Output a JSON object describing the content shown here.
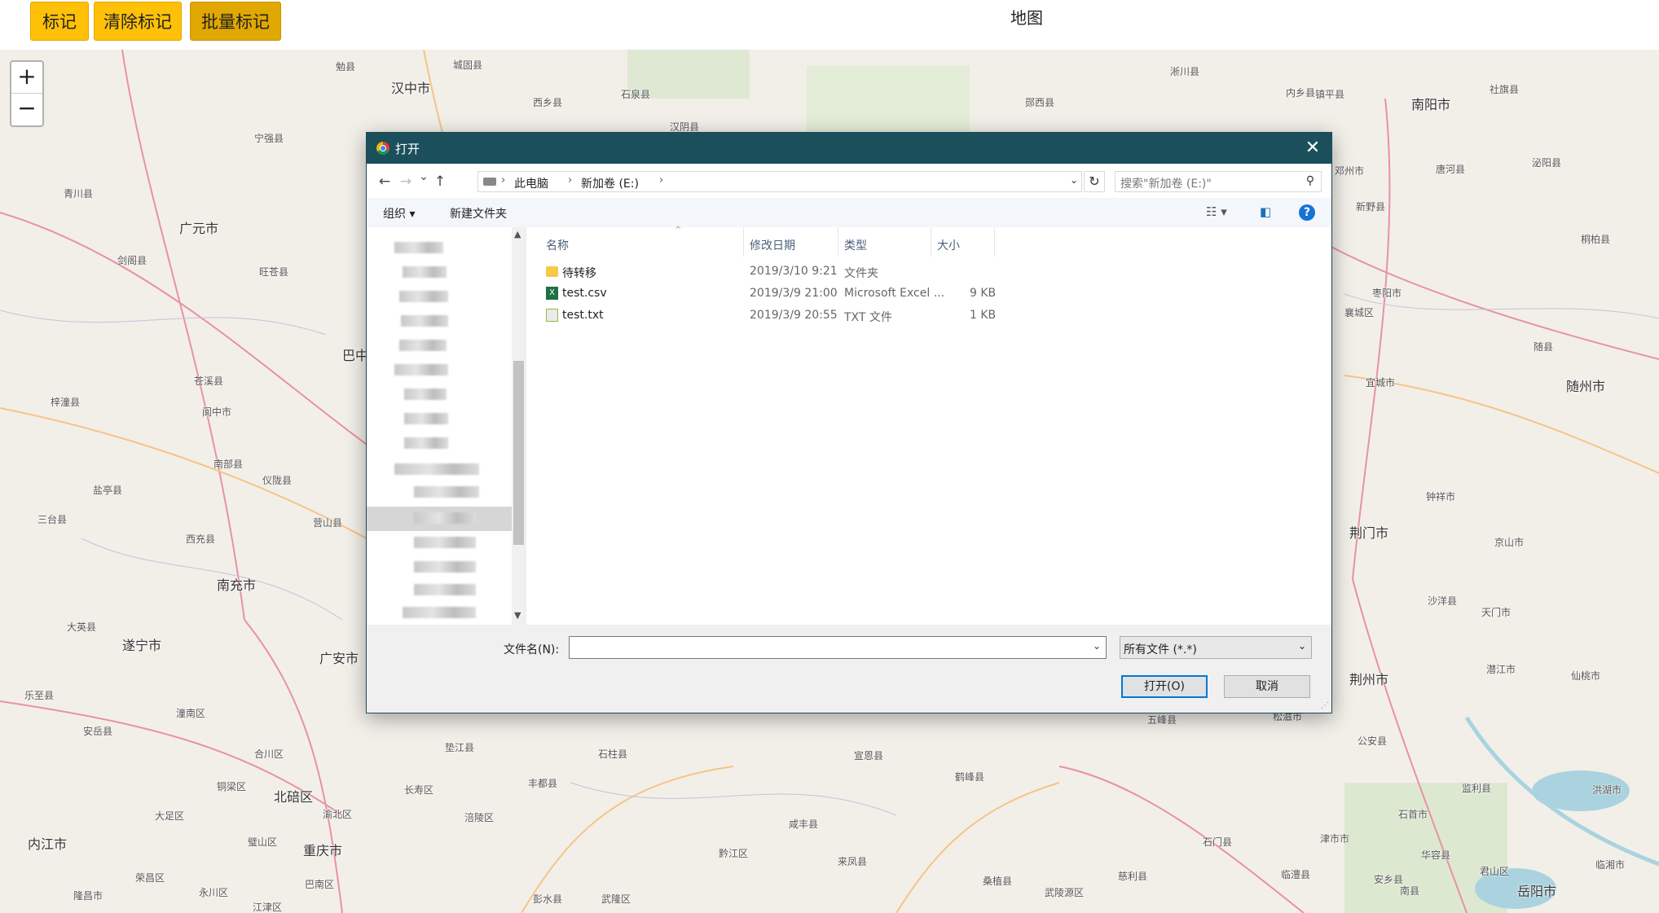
{
  "toolbar": {
    "mark_label": "标记",
    "clear_label": "清除标记",
    "batch_label": "批量标记",
    "map_title": "地图"
  },
  "zoom": {
    "in": "+",
    "out": "−"
  },
  "map_labels": [
    {
      "text": "汉中市",
      "city": true
    },
    {
      "text": "南阳市",
      "city": true
    },
    {
      "text": "广元市",
      "city": true
    },
    {
      "text": "巴中",
      "city": true
    },
    {
      "text": "南充市",
      "city": true
    },
    {
      "text": "遂宁市",
      "city": true
    },
    {
      "text": "广安市",
      "city": true
    },
    {
      "text": "北碚区",
      "city": true
    },
    {
      "text": "重庆市",
      "city": true
    },
    {
      "text": "内江市",
      "city": true
    },
    {
      "text": "荆门市",
      "city": true
    },
    {
      "text": "荆州市",
      "city": true
    },
    {
      "text": "随州市",
      "city": true
    },
    {
      "text": "岳阳市",
      "city": true
    },
    {
      "text": "宁强县",
      "city": false
    },
    {
      "text": "青川县",
      "city": false
    },
    {
      "text": "剑阁县",
      "city": false
    },
    {
      "text": "旺苍县",
      "city": false
    },
    {
      "text": "苍溪县",
      "city": false
    },
    {
      "text": "阆中市",
      "city": false
    },
    {
      "text": "梓潼县",
      "city": false
    },
    {
      "text": "南部县",
      "city": false
    },
    {
      "text": "仪陇县",
      "city": false
    },
    {
      "text": "盐亭县",
      "city": false
    },
    {
      "text": "三台县",
      "city": false
    },
    {
      "text": "西充县",
      "city": false
    },
    {
      "text": "营山县",
      "city": false
    },
    {
      "text": "大英县",
      "city": false
    },
    {
      "text": "乐至县",
      "city": false
    },
    {
      "text": "安岳县",
      "city": false
    },
    {
      "text": "潼南区",
      "city": false
    },
    {
      "text": "合川区",
      "city": false
    },
    {
      "text": "铜梁区",
      "city": false
    },
    {
      "text": "大足区",
      "city": false
    },
    {
      "text": "长寿区",
      "city": false
    },
    {
      "text": "涪陵区",
      "city": false
    },
    {
      "text": "丰都县",
      "city": false
    },
    {
      "text": "石柱县",
      "city": false
    },
    {
      "text": "宣恩县",
      "city": false
    },
    {
      "text": "鹤峰县",
      "city": false
    },
    {
      "text": "五峰县",
      "city": false
    },
    {
      "text": "松滋市",
      "city": false
    },
    {
      "text": "公安县",
      "city": false
    },
    {
      "text": "监利县",
      "city": false
    },
    {
      "text": "洪湖市",
      "city": false
    },
    {
      "text": "石首市",
      "city": false
    },
    {
      "text": "华容县",
      "city": false
    },
    {
      "text": "潜江市",
      "city": false
    },
    {
      "text": "仙桃市",
      "city": false
    },
    {
      "text": "天门市",
      "city": false
    },
    {
      "text": "沙洋县",
      "city": false
    },
    {
      "text": "京山市",
      "city": false
    },
    {
      "text": "钟祥市",
      "city": false
    },
    {
      "text": "宜城市",
      "city": false
    },
    {
      "text": "襄城区",
      "city": false
    },
    {
      "text": "随县",
      "city": false
    },
    {
      "text": "枣阳市",
      "city": false
    },
    {
      "text": "新野县",
      "city": false
    },
    {
      "text": "邓州市",
      "city": false
    },
    {
      "text": "唐河县",
      "city": false
    },
    {
      "text": "社旗县",
      "city": false
    },
    {
      "text": "泌阳县",
      "city": false
    },
    {
      "text": "桐柏县",
      "city": false
    },
    {
      "text": "镇平县",
      "city": false
    },
    {
      "text": "内乡县",
      "city": false
    },
    {
      "text": "淅川县",
      "city": false
    },
    {
      "text": "郧西县",
      "city": false
    },
    {
      "text": "汉阴县",
      "city": false
    },
    {
      "text": "石泉县",
      "city": false
    },
    {
      "text": "西乡县",
      "city": false
    },
    {
      "text": "城固县",
      "city": false
    },
    {
      "text": "勉县",
      "city": false
    },
    {
      "text": "彭水县",
      "city": false
    },
    {
      "text": "武隆区",
      "city": false
    },
    {
      "text": "黔江区",
      "city": false
    },
    {
      "text": "咸丰县",
      "city": false
    },
    {
      "text": "来凤县",
      "city": false
    },
    {
      "text": "桑植县",
      "city": false
    },
    {
      "text": "武陵源区",
      "city": false
    },
    {
      "text": "慈利县",
      "city": false
    },
    {
      "text": "石门县",
      "city": false
    },
    {
      "text": "临澧县",
      "city": false
    },
    {
      "text": "津市市",
      "city": false
    },
    {
      "text": "安乡县",
      "city": false
    },
    {
      "text": "南县",
      "city": false
    },
    {
      "text": "君山区",
      "city": false
    },
    {
      "text": "临湘市",
      "city": false
    },
    {
      "text": "洪湖市",
      "city": false
    },
    {
      "text": "江津区",
      "city": false
    },
    {
      "text": "巴南区",
      "city": false
    },
    {
      "text": "永川区",
      "city": false
    },
    {
      "text": "荣昌区",
      "city": false
    },
    {
      "text": "隆昌市",
      "city": false
    },
    {
      "text": "璧山区",
      "city": false
    },
    {
      "text": "渝北区",
      "city": false
    },
    {
      "text": "垫江县",
      "city": false
    }
  ],
  "dialog": {
    "title": "打开",
    "close": "✕",
    "nav": {
      "back": "←",
      "forward": "→",
      "recent": "⌄",
      "up": "↑"
    },
    "breadcrumb": [
      "此电脑",
      "新加卷 (E:)"
    ],
    "search_placeholder": "搜索\"新加卷 (E:)\"",
    "commands": {
      "organize": "组织 ▾",
      "new_folder": "新建文件夹"
    },
    "help": "?",
    "columns": {
      "name": "名称",
      "modified": "修改日期",
      "type": "类型",
      "size": "大小"
    },
    "files": [
      {
        "name": "待转移",
        "modified": "2019/3/10 9:21",
        "type": "文件夹",
        "size": "",
        "icon": "folder-icon"
      },
      {
        "name": "test.csv",
        "modified": "2019/3/9 21:00",
        "type": "Microsoft Excel ...",
        "size": "9 KB",
        "icon": "excel-file-icon"
      },
      {
        "name": "test.txt",
        "modified": "2019/3/9 20:55",
        "type": "TXT 文件",
        "size": "1 KB",
        "icon": "text-file-icon"
      }
    ],
    "filename_label": "文件名(N):",
    "filename_value": "",
    "filetype_value": "所有文件 (*.*)",
    "open_label": "打开(O)",
    "cancel_label": "取消"
  },
  "colors": {
    "button_yellow": "#ffc107",
    "titlebar": "#1c4f5c",
    "map_bg": "#f2efe9"
  }
}
